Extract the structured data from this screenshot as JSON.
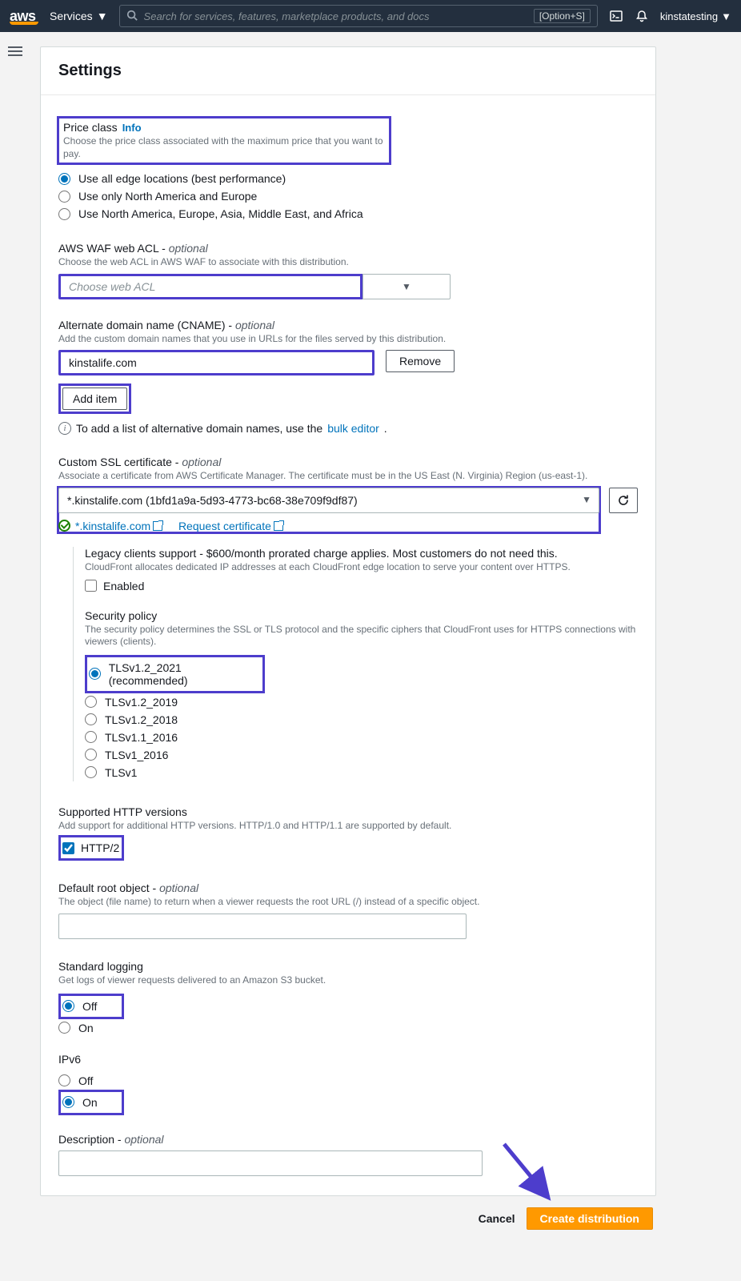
{
  "nav": {
    "logo": "aws",
    "services": "Services",
    "search_placeholder": "Search for services, features, marketplace products, and docs",
    "shortcut": "[Option+S]",
    "account": "kinstatesting"
  },
  "page": {
    "title": "Settings"
  },
  "price_class": {
    "label": "Price class",
    "info": "Info",
    "help": "Choose the price class associated with the maximum price that you want to pay.",
    "options": [
      "Use all edge locations (best performance)",
      "Use only North America and Europe",
      "Use North America, Europe, Asia, Middle East, and Africa"
    ],
    "selected": 0
  },
  "waf": {
    "label": "AWS WAF web ACL - ",
    "opt": "optional",
    "help": "Choose the web ACL in AWS WAF to associate with this distribution.",
    "placeholder": "Choose web ACL"
  },
  "cname": {
    "label": "Alternate domain name (CNAME) - ",
    "opt": "optional",
    "help": "Add the custom domain names that you use in URLs for the files served by this distribution.",
    "value": "kinstalife.com",
    "remove": "Remove",
    "add": "Add item",
    "note_prefix": "To add a list of alternative domain names, use the ",
    "note_link": "bulk editor"
  },
  "ssl": {
    "label": "Custom SSL certificate - ",
    "opt": "optional",
    "help": "Associate a certificate from AWS Certificate Manager. The certificate must be in the US East (N. Virginia) Region (us-east-1).",
    "value": "*.kinstalife.com (1bfd1a9a-5d93-4773-bc68-38e709f9df87)",
    "status_domain": "*.kinstalife.com",
    "request": "Request certificate"
  },
  "legacy": {
    "label": "Legacy clients support - $600/month prorated charge applies. Most customers do not need this.",
    "help": "CloudFront allocates dedicated IP addresses at each CloudFront edge location to serve your content over HTTPS.",
    "checkbox": "Enabled"
  },
  "security": {
    "label": "Security policy",
    "help": "The security policy determines the SSL or TLS protocol and the specific ciphers that CloudFront uses for HTTPS connections with viewers (clients).",
    "options": [
      "TLSv1.2_2021 (recommended)",
      "TLSv1.2_2019",
      "TLSv1.2_2018",
      "TLSv1.1_2016",
      "TLSv1_2016",
      "TLSv1"
    ],
    "selected": 0
  },
  "http": {
    "label": "Supported HTTP versions",
    "help": "Add support for additional HTTP versions. HTTP/1.0 and HTTP/1.1 are supported by default.",
    "checkbox": "HTTP/2"
  },
  "root": {
    "label": "Default root object - ",
    "opt": "optional",
    "help": "The object (file name) to return when a viewer requests the root URL (/) instead of a specific object."
  },
  "logging": {
    "label": "Standard logging",
    "help": "Get logs of viewer requests delivered to an Amazon S3 bucket.",
    "options": [
      "Off",
      "On"
    ],
    "selected": 0
  },
  "ipv6": {
    "label": "IPv6",
    "options": [
      "Off",
      "On"
    ],
    "selected": 1
  },
  "desc": {
    "label": "Description - ",
    "opt": "optional"
  },
  "footer": {
    "cancel": "Cancel",
    "create": "Create distribution"
  }
}
